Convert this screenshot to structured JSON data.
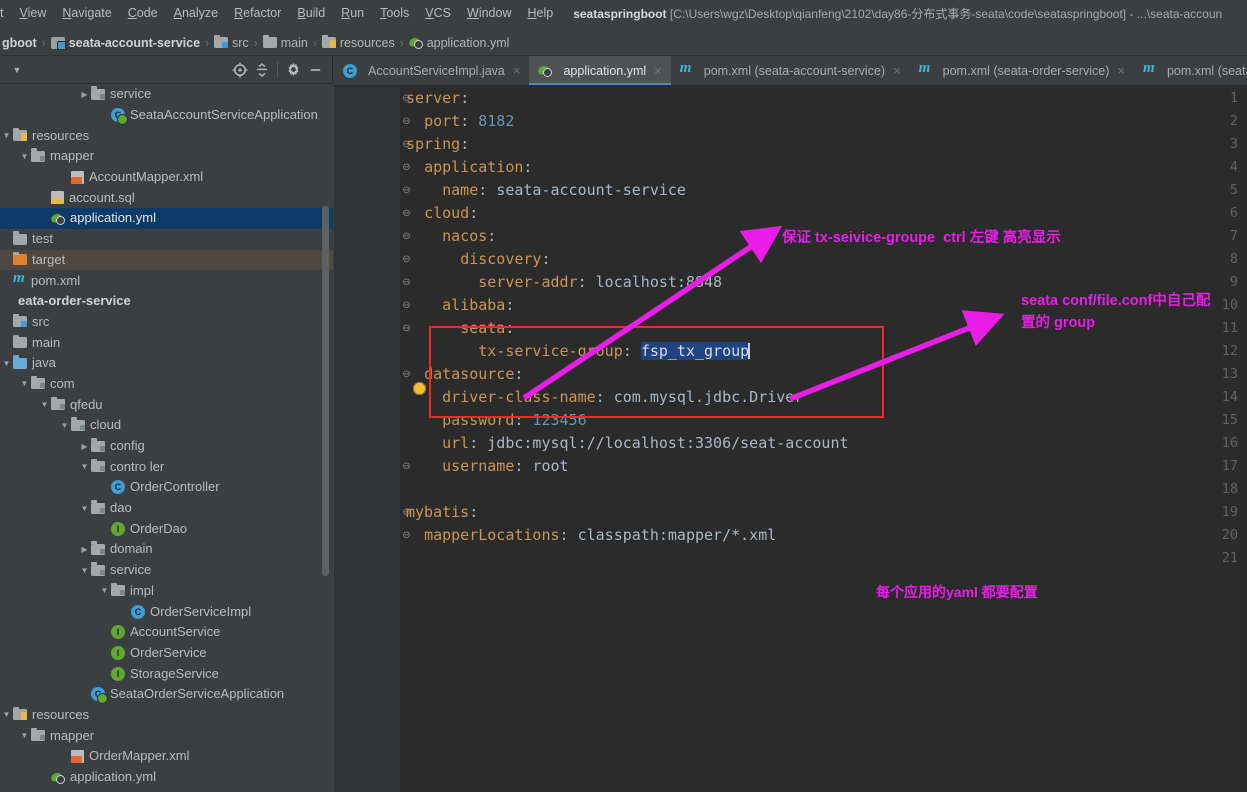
{
  "window": {
    "title_app": "seataspringboot",
    "title_path": "[C:\\Users\\wgz\\Desktop\\qianfeng\\2102\\day86-分布式事务-seata\\code\\seataspringboot] - ...\\seata-accoun"
  },
  "menubar": {
    "items": [
      "t",
      "View",
      "Navigate",
      "Code",
      "Analyze",
      "Refactor",
      "Build",
      "Run",
      "Tools",
      "VCS",
      "Window",
      "Help"
    ]
  },
  "breadcrumbs": {
    "items": [
      {
        "label": "gboot",
        "icon": "none",
        "bold": true
      },
      {
        "label": "seata-account-service",
        "icon": "module-icon",
        "bold": true
      },
      {
        "label": "src",
        "icon": "folder-src-icon",
        "bold": false
      },
      {
        "label": "main",
        "icon": "folder-icon",
        "bold": false
      },
      {
        "label": "resources",
        "icon": "folder-resources-icon",
        "bold": false
      },
      {
        "label": "application.yml",
        "icon": "yaml-icon",
        "bold": false
      }
    ],
    "separator": "›"
  },
  "project_panel": {
    "toolbar": {
      "dropdown": "▼",
      "locate_icon": "locate-target-icon",
      "collapse_icon": "collapse-all-icon",
      "settings_icon": "gear-icon",
      "minimize_icon": "minimize-icon"
    },
    "tree": [
      {
        "indent": 5,
        "arrow": "▶",
        "icon": "folder-pkg-icon",
        "label": "service",
        "state": "normal"
      },
      {
        "indent": 6,
        "arrow": "",
        "icon": "spring-class-icon",
        "label": "SeataAccountServiceApplication",
        "state": "normal"
      },
      {
        "indent": 1,
        "arrow": "▼",
        "icon": "folder-resources-icon",
        "label": "resources",
        "state": "normal"
      },
      {
        "indent": 2,
        "arrow": "▼",
        "icon": "folder-pkg-icon",
        "label": "mapper",
        "state": "normal"
      },
      {
        "indent": 4,
        "arrow": "",
        "icon": "xml-icon",
        "label": "AccountMapper.xml",
        "state": "normal"
      },
      {
        "indent": 3,
        "arrow": "",
        "icon": "sql-icon",
        "label": "account.sql",
        "state": "normal"
      },
      {
        "indent": 3,
        "arrow": "",
        "icon": "yaml-icon",
        "label": "application.yml",
        "state": "selected"
      },
      {
        "indent": 0,
        "arrow": "",
        "icon": "folder-icon",
        "label": "test",
        "state": "normal"
      },
      {
        "indent": 0,
        "arrow": "",
        "icon": "folder-target-icon",
        "label": "target",
        "state": "target"
      },
      {
        "indent": 0,
        "arrow": "",
        "icon": "maven-icon",
        "label": "pom.xml",
        "state": "normal"
      },
      {
        "indent": 0,
        "arrow": "",
        "icon": "none",
        "label": "eata-order-service",
        "state": "bold"
      },
      {
        "indent": 0,
        "arrow": "",
        "icon": "folder-src-icon",
        "label": "src",
        "state": "normal"
      },
      {
        "indent": 0,
        "arrow": "",
        "icon": "folder-icon",
        "label": "main",
        "state": "normal"
      },
      {
        "indent": 1,
        "arrow": "▼",
        "icon": "folder-java-icon",
        "label": "java",
        "state": "normal"
      },
      {
        "indent": 2,
        "arrow": "▼",
        "icon": "folder-pkg-icon",
        "label": "com",
        "state": "normal"
      },
      {
        "indent": 3,
        "arrow": "▼",
        "icon": "folder-pkg-icon",
        "label": "qfedu",
        "state": "normal"
      },
      {
        "indent": 4,
        "arrow": "▼",
        "icon": "folder-pkg-icon",
        "label": "cloud",
        "state": "normal"
      },
      {
        "indent": 5,
        "arrow": "▶",
        "icon": "folder-pkg-icon",
        "label": "config",
        "state": "normal"
      },
      {
        "indent": 5,
        "arrow": "▼",
        "icon": "folder-pkg-icon",
        "label": "contro ler",
        "state": "normal"
      },
      {
        "indent": 6,
        "arrow": "",
        "icon": "class-icon",
        "label": "OrderController",
        "state": "normal"
      },
      {
        "indent": 5,
        "arrow": "▼",
        "icon": "folder-pkg-icon",
        "label": "dao",
        "state": "normal"
      },
      {
        "indent": 6,
        "arrow": "",
        "icon": "interface-icon",
        "label": "OrderDao",
        "state": "normal"
      },
      {
        "indent": 5,
        "arrow": "▶",
        "icon": "folder-pkg-icon",
        "label": "domain",
        "state": "normal"
      },
      {
        "indent": 5,
        "arrow": "▼",
        "icon": "folder-pkg-icon",
        "label": "service",
        "state": "normal"
      },
      {
        "indent": 6,
        "arrow": "▼",
        "icon": "folder-pkg-icon",
        "label": "impl",
        "state": "normal"
      },
      {
        "indent": 7,
        "arrow": "",
        "icon": "class-icon",
        "label": "OrderServiceImpl",
        "state": "normal"
      },
      {
        "indent": 6,
        "arrow": "",
        "icon": "interface-icon",
        "label": "AccountService",
        "state": "normal"
      },
      {
        "indent": 6,
        "arrow": "",
        "icon": "interface-icon",
        "label": "OrderService",
        "state": "normal"
      },
      {
        "indent": 6,
        "arrow": "",
        "icon": "interface-icon",
        "label": "StorageService",
        "state": "normal"
      },
      {
        "indent": 5,
        "arrow": "",
        "icon": "spring-class-icon",
        "label": "SeataOrderServiceApplication",
        "state": "normal"
      },
      {
        "indent": 1,
        "arrow": "▼",
        "icon": "folder-resources-icon",
        "label": "resources",
        "state": "normal"
      },
      {
        "indent": 2,
        "arrow": "▼",
        "icon": "folder-pkg-icon",
        "label": "mapper",
        "state": "normal"
      },
      {
        "indent": 4,
        "arrow": "",
        "icon": "xml-icon",
        "label": "OrderMapper.xml",
        "state": "normal"
      },
      {
        "indent": 3,
        "arrow": "",
        "icon": "yaml-icon",
        "label": "application.yml",
        "state": "normal"
      }
    ]
  },
  "editor_tabs": [
    {
      "label": "AccountServiceImpl.java",
      "icon": "class-icon",
      "active": false,
      "close": "×"
    },
    {
      "label": "application.yml",
      "icon": "yaml-icon",
      "active": true,
      "close": "×"
    },
    {
      "label": "pom.xml (seata-account-service)",
      "icon": "maven-icon",
      "active": false,
      "close": "×"
    },
    {
      "label": "pom.xml (seata-order-service)",
      "icon": "maven-icon",
      "active": false,
      "close": "×"
    },
    {
      "label": "pom.xml (seata-",
      "icon": "maven-icon",
      "active": false,
      "close": ""
    }
  ],
  "editor": {
    "filename": "application.yml",
    "selected_text": "fsp_tx_group",
    "lines": [
      {
        "no": "1",
        "fold": "⊖",
        "indent": 0,
        "tokens": [
          {
            "t": "server",
            "c": "k"
          },
          {
            "t": ":",
            "c": "p"
          }
        ]
      },
      {
        "no": "2",
        "fold": "⊖",
        "indent": 1,
        "tokens": [
          {
            "t": "port",
            "c": "k"
          },
          {
            "t": ": ",
            "c": "p"
          },
          {
            "t": "8182",
            "c": "num"
          }
        ]
      },
      {
        "no": "3",
        "fold": "⊖",
        "indent": 0,
        "tokens": [
          {
            "t": "spring",
            "c": "k"
          },
          {
            "t": ":",
            "c": "p"
          }
        ]
      },
      {
        "no": "4",
        "fold": "⊖",
        "indent": 1,
        "tokens": [
          {
            "t": "application",
            "c": "k"
          },
          {
            "t": ":",
            "c": "p"
          }
        ]
      },
      {
        "no": "5",
        "fold": "⊖",
        "indent": 2,
        "tokens": [
          {
            "t": "name",
            "c": "k"
          },
          {
            "t": ": ",
            "c": "p"
          },
          {
            "t": "seata-account-service",
            "c": "str"
          }
        ]
      },
      {
        "no": "6",
        "fold": "⊖",
        "indent": 1,
        "tokens": [
          {
            "t": "cloud",
            "c": "k"
          },
          {
            "t": ":",
            "c": "p"
          }
        ]
      },
      {
        "no": "7",
        "fold": "⊖",
        "indent": 2,
        "tokens": [
          {
            "t": "nacos",
            "c": "k"
          },
          {
            "t": ":",
            "c": "p"
          }
        ]
      },
      {
        "no": "8",
        "fold": "⊖",
        "indent": 3,
        "tokens": [
          {
            "t": "discovery",
            "c": "k"
          },
          {
            "t": ":",
            "c": "p"
          }
        ]
      },
      {
        "no": "9",
        "fold": "⊖",
        "indent": 4,
        "tokens": [
          {
            "t": "server-addr",
            "c": "k"
          },
          {
            "t": ": ",
            "c": "p"
          },
          {
            "t": "localhost:8848",
            "c": "str"
          }
        ]
      },
      {
        "no": "10",
        "fold": "⊖",
        "indent": 2,
        "tokens": [
          {
            "t": "alibaba",
            "c": "k"
          },
          {
            "t": ":",
            "c": "p"
          }
        ]
      },
      {
        "no": "11",
        "fold": "⊖",
        "indent": 3,
        "tokens": [
          {
            "t": "seata",
            "c": "k"
          },
          {
            "t": ":",
            "c": "p"
          }
        ]
      },
      {
        "no": "12",
        "fold": "",
        "indent": 4,
        "tokens": [
          {
            "t": "tx-service-group",
            "c": "k"
          },
          {
            "t": ": ",
            "c": "p"
          },
          {
            "t": "fsp_tx_group",
            "c": "sel"
          }
        ]
      },
      {
        "no": "13",
        "fold": "⊖",
        "indent": 1,
        "tokens": [
          {
            "t": "datasource",
            "c": "k"
          },
          {
            "t": ":",
            "c": "p"
          }
        ]
      },
      {
        "no": "14",
        "fold": "",
        "indent": 2,
        "tokens": [
          {
            "t": "driver-class-name",
            "c": "k"
          },
          {
            "t": ": ",
            "c": "p"
          },
          {
            "t": "com.mysql.jdbc.Driver",
            "c": "str"
          }
        ]
      },
      {
        "no": "15",
        "fold": "",
        "indent": 2,
        "tokens": [
          {
            "t": "password",
            "c": "k"
          },
          {
            "t": ": ",
            "c": "p"
          },
          {
            "t": "123456",
            "c": "num"
          }
        ]
      },
      {
        "no": "16",
        "fold": "",
        "indent": 2,
        "tokens": [
          {
            "t": "url",
            "c": "k"
          },
          {
            "t": ": ",
            "c": "p"
          },
          {
            "t": "jdbc:mysql://localhost:3306/seat-account",
            "c": "str"
          }
        ]
      },
      {
        "no": "17",
        "fold": "⊖",
        "indent": 2,
        "tokens": [
          {
            "t": "username",
            "c": "k"
          },
          {
            "t": ": ",
            "c": "p"
          },
          {
            "t": "root",
            "c": "str"
          }
        ]
      },
      {
        "no": "18",
        "fold": "",
        "indent": 0,
        "tokens": []
      },
      {
        "no": "19",
        "fold": "⊖",
        "indent": 0,
        "tokens": [
          {
            "t": "mybatis",
            "c": "k"
          },
          {
            "t": ":",
            "c": "p"
          }
        ]
      },
      {
        "no": "20",
        "fold": "⊖",
        "indent": 1,
        "tokens": [
          {
            "t": "mapperLocations",
            "c": "k"
          },
          {
            "t": ": ",
            "c": "p"
          },
          {
            "t": "classpath:mapper/*.xml",
            "c": "str"
          }
        ]
      },
      {
        "no": "21",
        "fold": "",
        "indent": 0,
        "tokens": []
      }
    ]
  },
  "annotations": {
    "color": "#e81ee8",
    "box_color": "#f2262b",
    "note1": "保证 tx-seivice-groupe  ctrl 左键 高亮显示",
    "note2": "seata conf/file.conf中自己配\n置的 group",
    "note3": "每个应用的yaml 都要配置"
  }
}
